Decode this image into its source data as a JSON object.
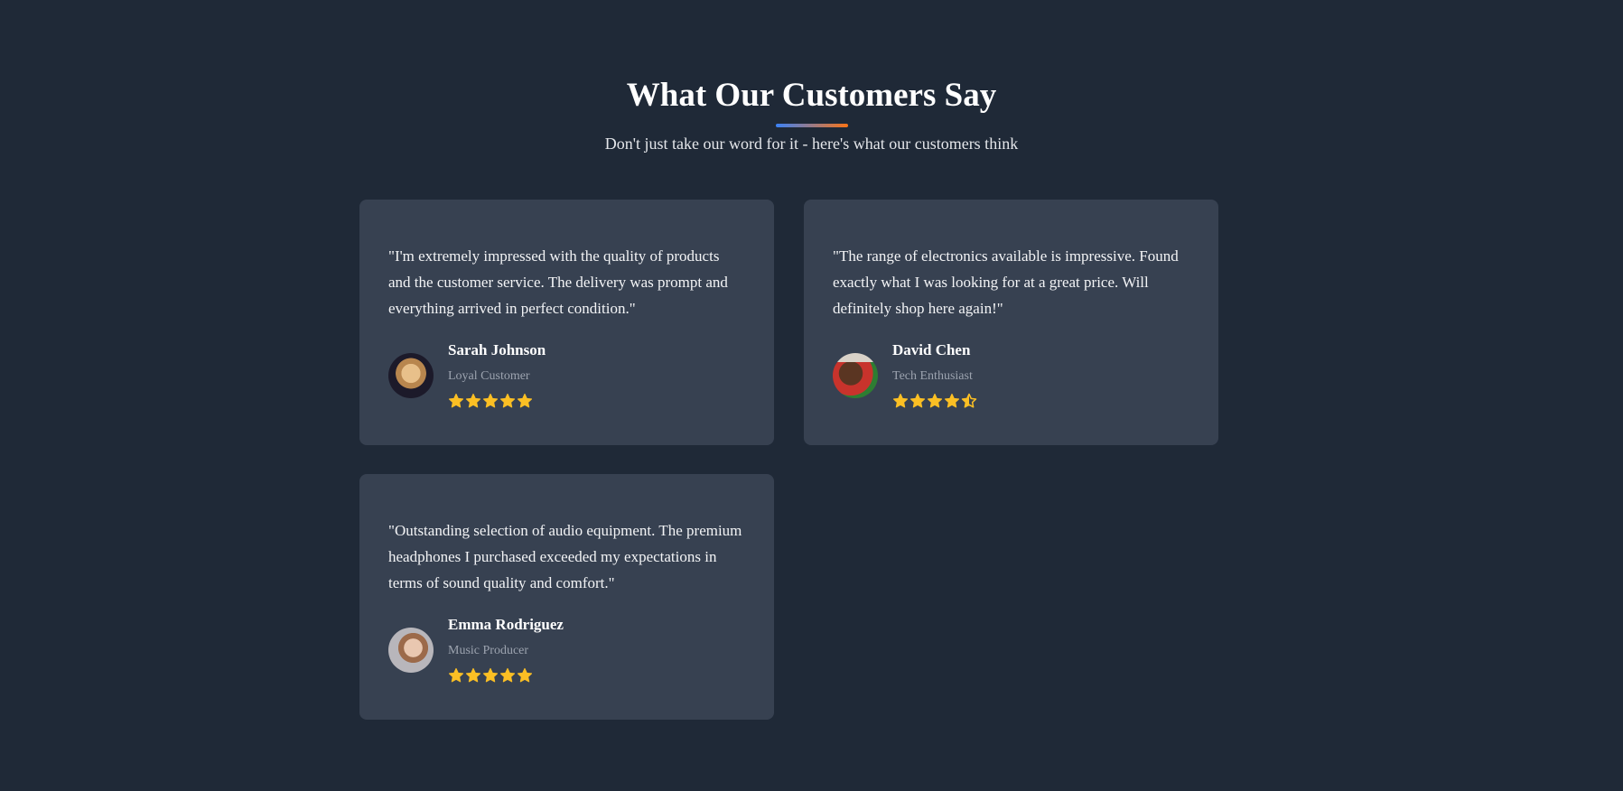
{
  "header": {
    "title": "What Our Customers Say",
    "subtitle": "Don't just take our word for it - here's what our customers think"
  },
  "colors": {
    "accent_start": "#3b82f6",
    "accent_end": "#f97316",
    "star": "#fbbf24",
    "background": "#1f2937",
    "card": "#374151"
  },
  "testimonials": [
    {
      "quote": "\"I'm extremely impressed with the quality of products and the customer service. The delivery was prompt and everything arrived in perfect condition.\"",
      "name": "Sarah Johnson",
      "role": "Loyal Customer",
      "rating": 5
    },
    {
      "quote": "\"The range of electronics available is impressive. Found exactly what I was looking for at a great price. Will definitely shop here again!\"",
      "name": "David Chen",
      "role": "Tech Enthusiast",
      "rating": 4.5
    },
    {
      "quote": "\"Outstanding selection of audio equipment. The premium headphones I purchased exceeded my expectations in terms of sound quality and comfort.\"",
      "name": "Emma Rodriguez",
      "role": "Music Producer",
      "rating": 5
    }
  ]
}
